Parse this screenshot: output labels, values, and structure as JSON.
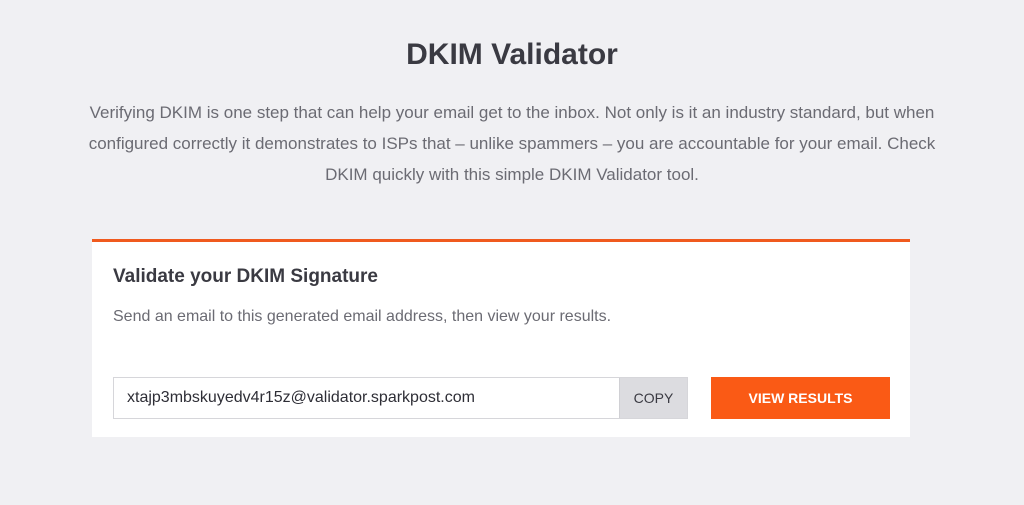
{
  "header": {
    "title": "DKIM Validator",
    "intro": "Verifying DKIM is one step that can help your email get to the inbox. Not only is it an industry standard, but when configured correctly it demonstrates to ISPs that – unlike spammers – you are accountable for your email. Check DKIM quickly with this simple DKIM Validator tool."
  },
  "card": {
    "heading": "Validate your DKIM Signature",
    "description": "Send an email to this generated email address, then view your results.",
    "email_value": "xtajp3mbskuyedv4r15z@validator.sparkpost.com",
    "copy_label": "COPY",
    "view_results_label": "VIEW RESULTS"
  },
  "colors": {
    "accent": "#fa5a15",
    "background": "#f0f0f3"
  }
}
